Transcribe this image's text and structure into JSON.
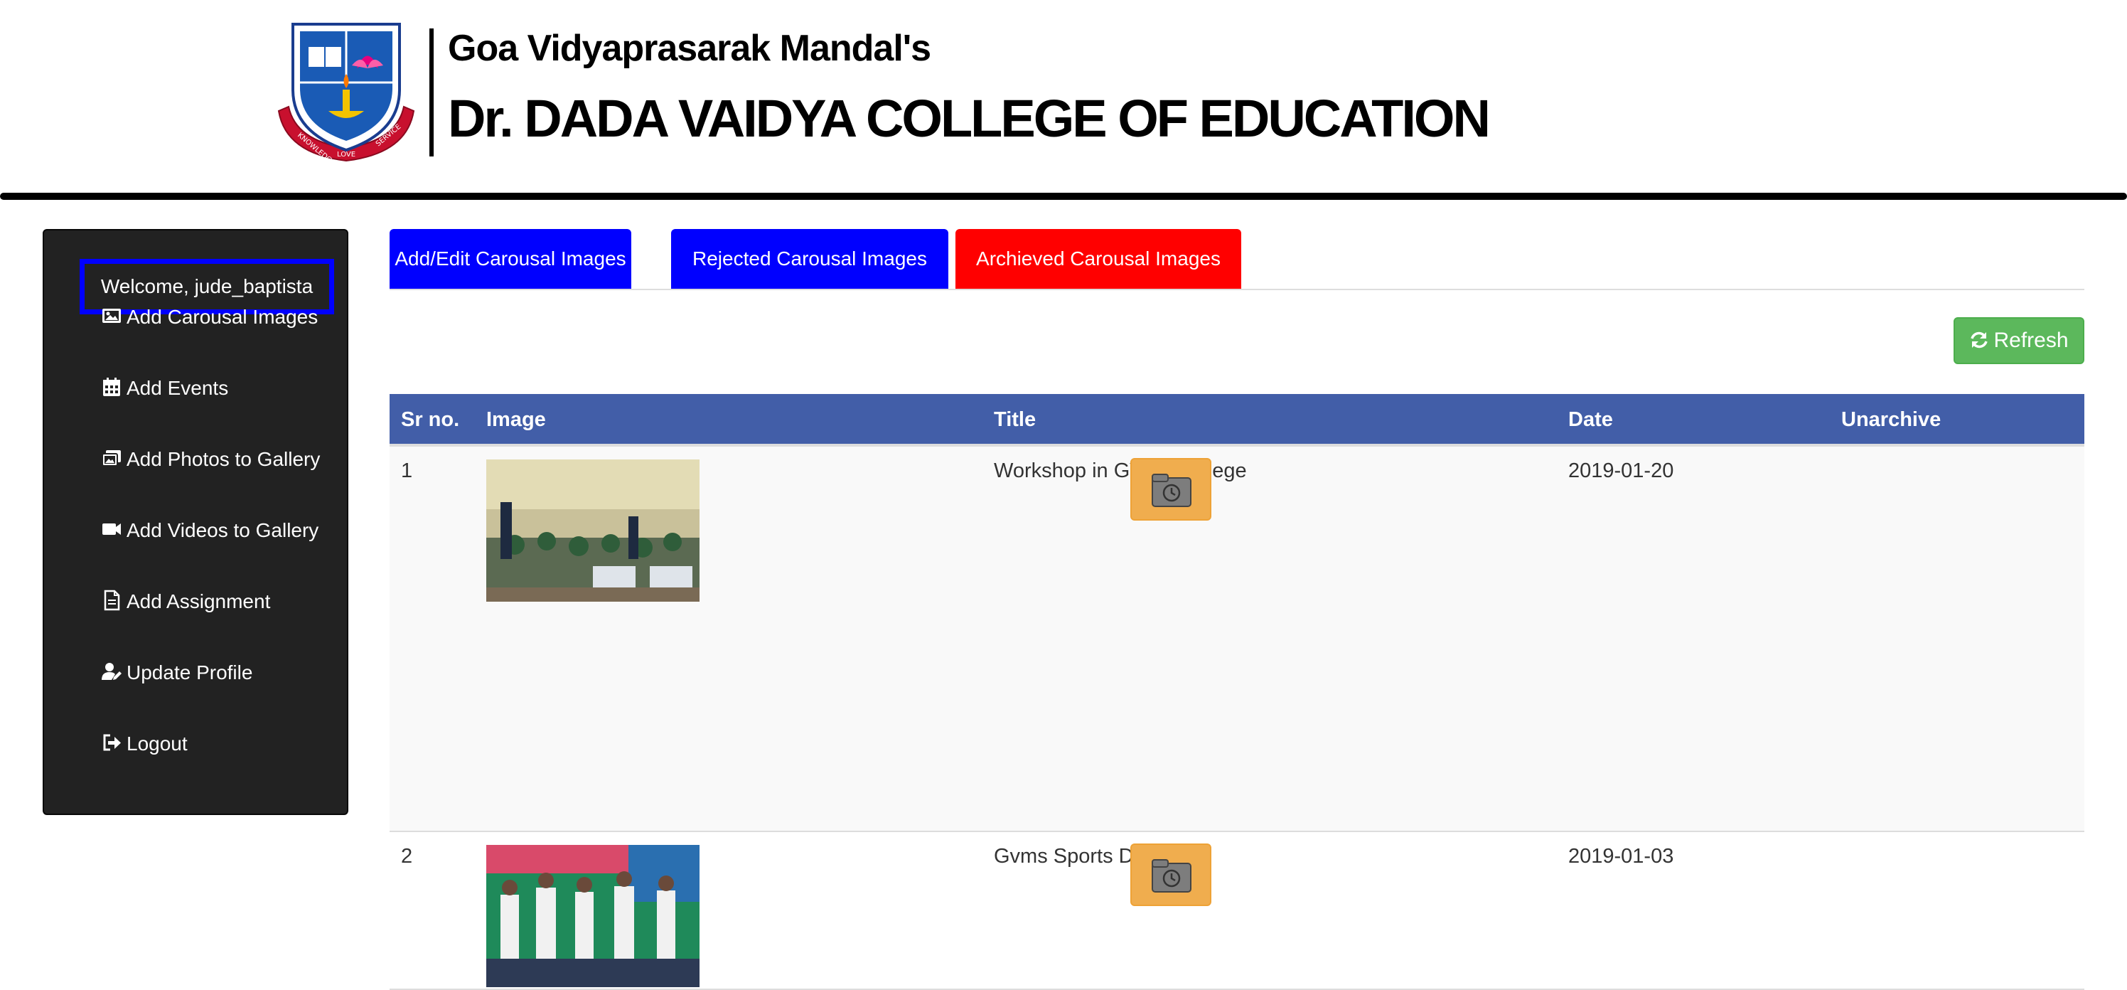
{
  "header": {
    "org_name": "Goa Vidyaprasarak Mandal's",
    "college_name": "Dr. DADA VAIDYA COLLEGE OF EDUCATION",
    "logo": {
      "icon": "college-crest-logo",
      "motto_left": "KNOWLEDGE",
      "motto_center": "LOVE",
      "motto_right": "SERVICE"
    }
  },
  "sidebar": {
    "welcome": "Welcome, jude_baptista",
    "items": [
      {
        "label": "Add Carousal Images",
        "icon": "image-icon"
      },
      {
        "label": "Add Events",
        "icon": "calendar-icon"
      },
      {
        "label": "Add Photos to Gallery",
        "icon": "images-icon"
      },
      {
        "label": "Add Videos to Gallery",
        "icon": "video-icon"
      },
      {
        "label": "Add Assignment",
        "icon": "file-icon"
      },
      {
        "label": "Update Profile",
        "icon": "user-edit-icon"
      },
      {
        "label": "Logout",
        "icon": "sign-out-icon"
      }
    ]
  },
  "tabs": [
    {
      "label": "Add/Edit Carousal Images",
      "color": "#0000ff"
    },
    {
      "label": "Rejected Carousal Images",
      "color": "#0000ff"
    },
    {
      "label": "Archieved Carousal Images",
      "color": "#ff0000",
      "active": true
    }
  ],
  "refresh": {
    "label": "Refresh",
    "icon": "refresh-icon",
    "color": "#5cb85c"
  },
  "table": {
    "header_color": "#425ea8",
    "columns": [
      "Sr no.",
      "Image",
      "Title",
      "Date",
      "Unarchive"
    ],
    "rows": [
      {
        "sr": "1",
        "title": "Workshop in GVMs College",
        "date": "2019-01-20",
        "image": "workshop-photo",
        "action_icon": "unarchive-icon"
      },
      {
        "sr": "2",
        "title": "Gvms Sports Day",
        "date": "2019-01-03",
        "image": "sports-day-photo",
        "action_icon": "unarchive-icon"
      }
    ]
  },
  "colors": {
    "sidebar_bg": "#222222",
    "welcome_border": "#0000ff",
    "unarchive_button": "#f0ad4e"
  }
}
